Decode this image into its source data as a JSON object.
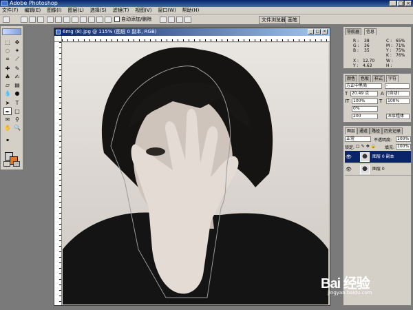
{
  "app": {
    "title": "Adobe Photoshop"
  },
  "menu": [
    "文件(F)",
    "编辑(E)",
    "图像(I)",
    "图层(L)",
    "选择(S)",
    "滤镜(T)",
    "视图(V)",
    "窗口(W)",
    "帮助(H)"
  ],
  "options": {
    "auto_add_delete": "自动添加/删除"
  },
  "well_tabs": [
    "文件浏览器",
    "画笔"
  ],
  "document": {
    "title": "6mg (8).jpg @ 115% (图层 0 副本, RGB)"
  },
  "navigator": {
    "tabs": [
      "导航器",
      "信息"
    ],
    "rgb": "R :\nG :\nB :",
    "rgb_values": "38\n36\n35",
    "cmyk": "C :\nM :\nY :\nK :",
    "cmyk_values": "65%\n71%\n75%\n76%",
    "xy": "X :\nY :",
    "xy_values": "12.70\n4.63",
    "wh": "W :\nH :"
  },
  "character": {
    "tabs": [
      "颜色",
      "色板",
      "样式",
      "字符"
    ],
    "font": "方正中黑简",
    "style": "-",
    "size": "20.49 点",
    "leading": "(自动)",
    "scale_v": "100%",
    "scale_h": "100%",
    "tracking_a": "0%",
    "tracking_b": "200",
    "aa": "浑厚粗体"
  },
  "layers": {
    "tabs": [
      "图层",
      "通道",
      "路径",
      "历史记录"
    ],
    "blend": "正常",
    "opacity_label": "不透明度:",
    "opacity": "100%",
    "lock_label": "锁定:",
    "fill_label": "填充:",
    "fill": "100%",
    "items": [
      {
        "name": "图层 0 副本",
        "selected": true
      },
      {
        "name": "图层 0",
        "selected": false
      }
    ]
  },
  "watermark": {
    "brand": "Bai 经验",
    "url": "jingyan.baidu.com"
  }
}
